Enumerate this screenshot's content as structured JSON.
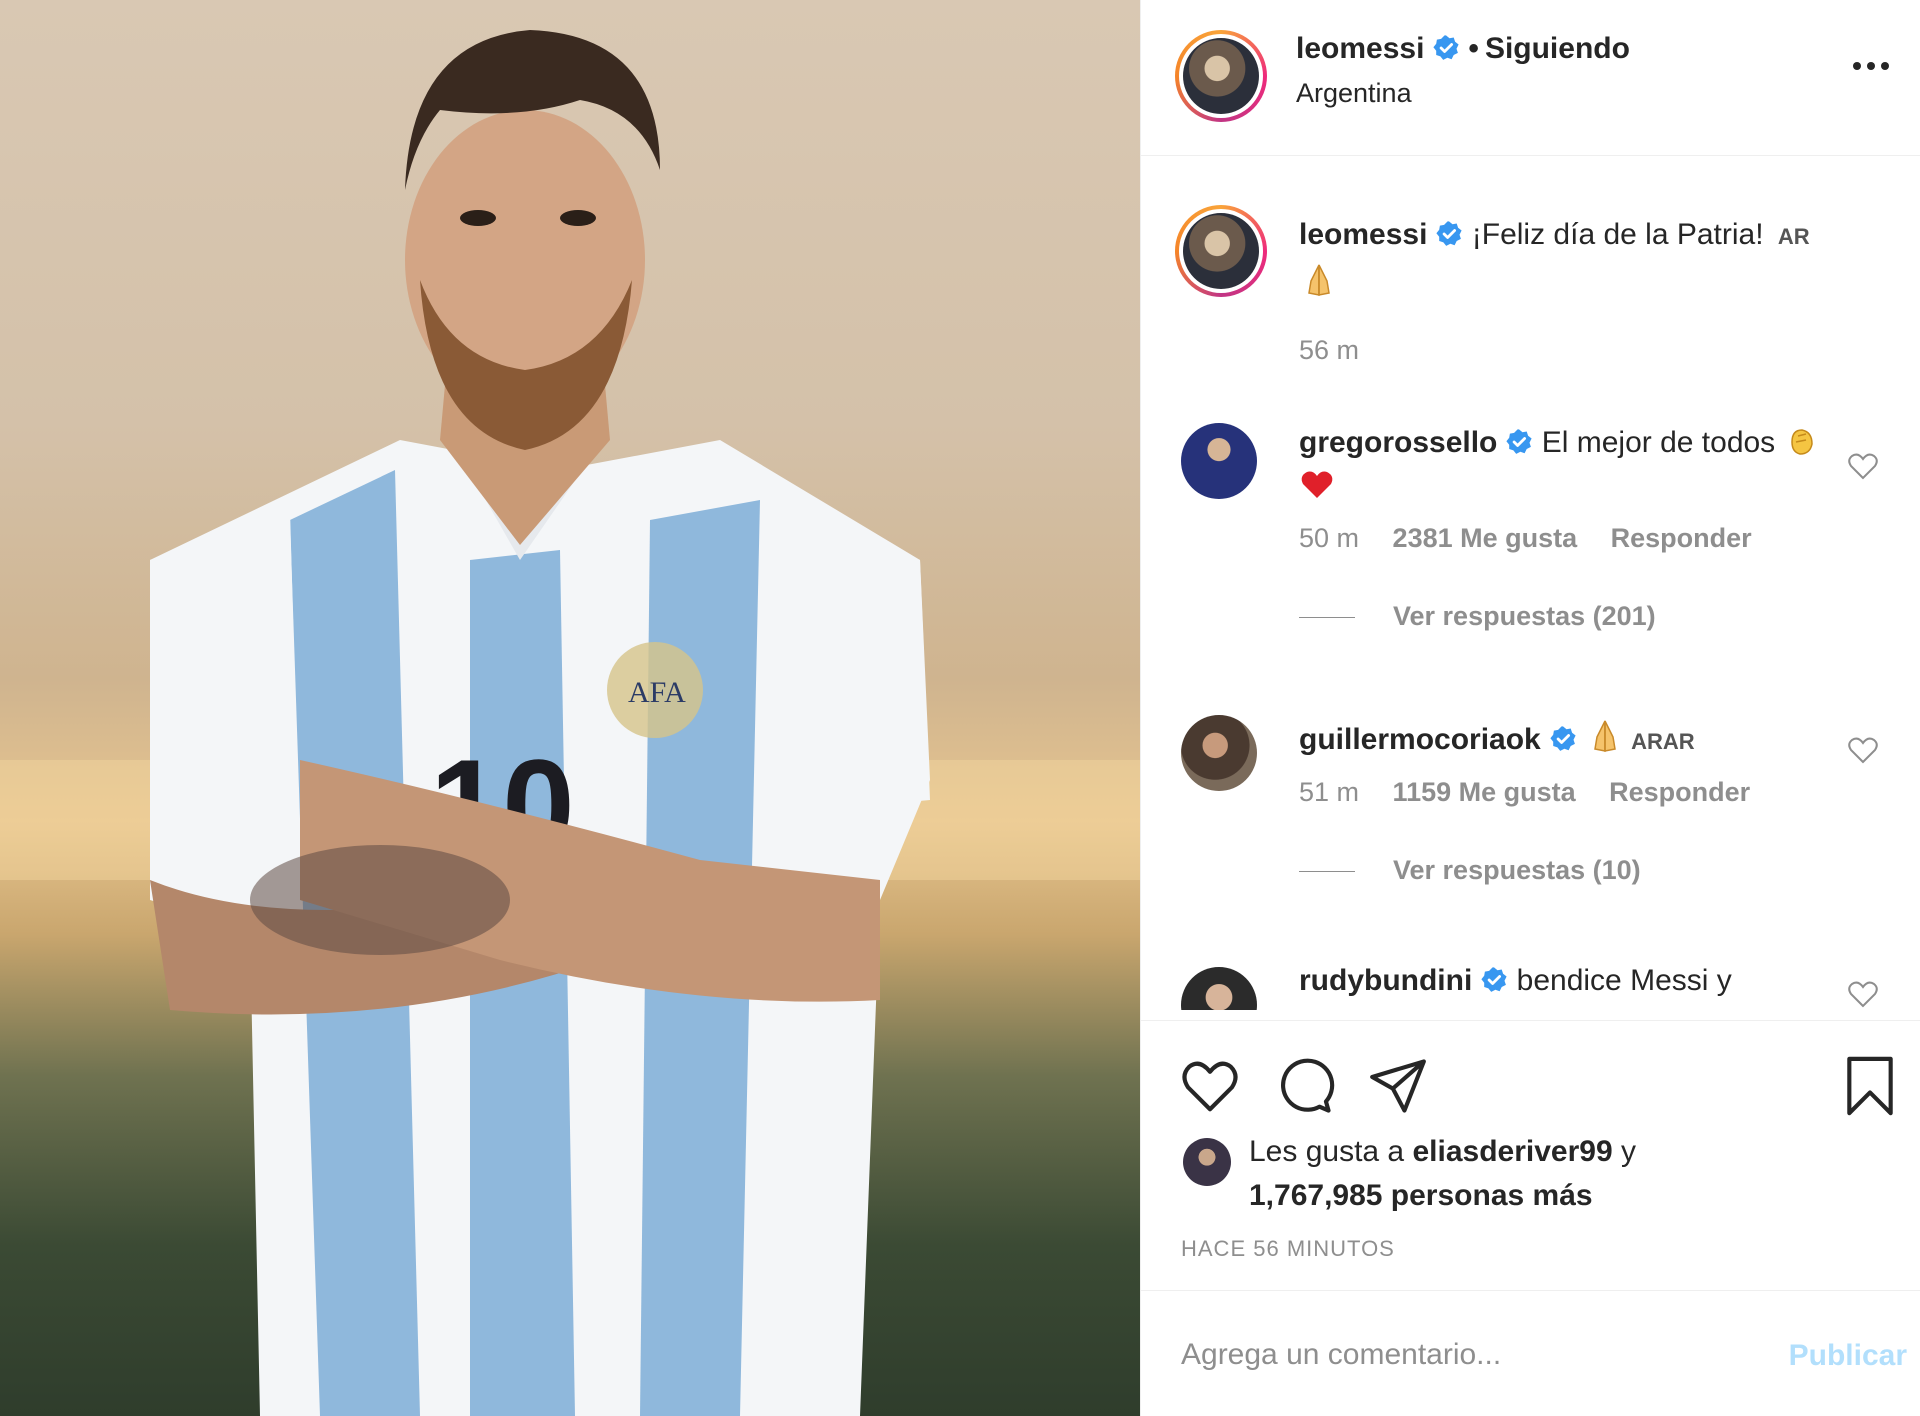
{
  "post": {
    "image_alt": "Lionel Messi con la camiseta de Argentina, brazos cruzados"
  },
  "header": {
    "username": "leomessi",
    "dot": "•",
    "follow_status": "Siguiendo",
    "location": "Argentina"
  },
  "caption": {
    "username": "leomessi",
    "text": "¡Feliz día de la Patria!",
    "flag": "AR",
    "time": "56 m"
  },
  "comments": [
    {
      "username": "gregorossello",
      "text": "El mejor de todos",
      "time": "50 m",
      "likes": "2381 Me gusta",
      "reply": "Responder",
      "view_replies": "Ver respuestas (201)"
    },
    {
      "username": "guillermocoriaok",
      "text": "",
      "flag": "ARAR",
      "time": "51 m",
      "likes": "1159 Me gusta",
      "reply": "Responder",
      "view_replies": "Ver respuestas (10)"
    },
    {
      "username": "rudybundini",
      "text": "bendice Messi y"
    }
  ],
  "likes": {
    "prefix": "Les gusta a",
    "user": "eliasderiver99",
    "join": "y",
    "count": "1,767,985 personas más"
  },
  "timeago": "HACE 56 MINUTOS",
  "add_comment": {
    "placeholder": "Agrega un comentario...",
    "publish_label": "Publicar"
  },
  "colors": {
    "verified": "#3897f0",
    "publish_disabled": "#b2dffc",
    "muted": "#8e8e8e"
  },
  "icons": [
    "verified-badge-icon",
    "more-options-icon",
    "heart-icon",
    "comment-icon",
    "share-icon",
    "bookmark-icon",
    "folded-hands-emoji",
    "clapping-emoji",
    "red-heart-emoji"
  ]
}
